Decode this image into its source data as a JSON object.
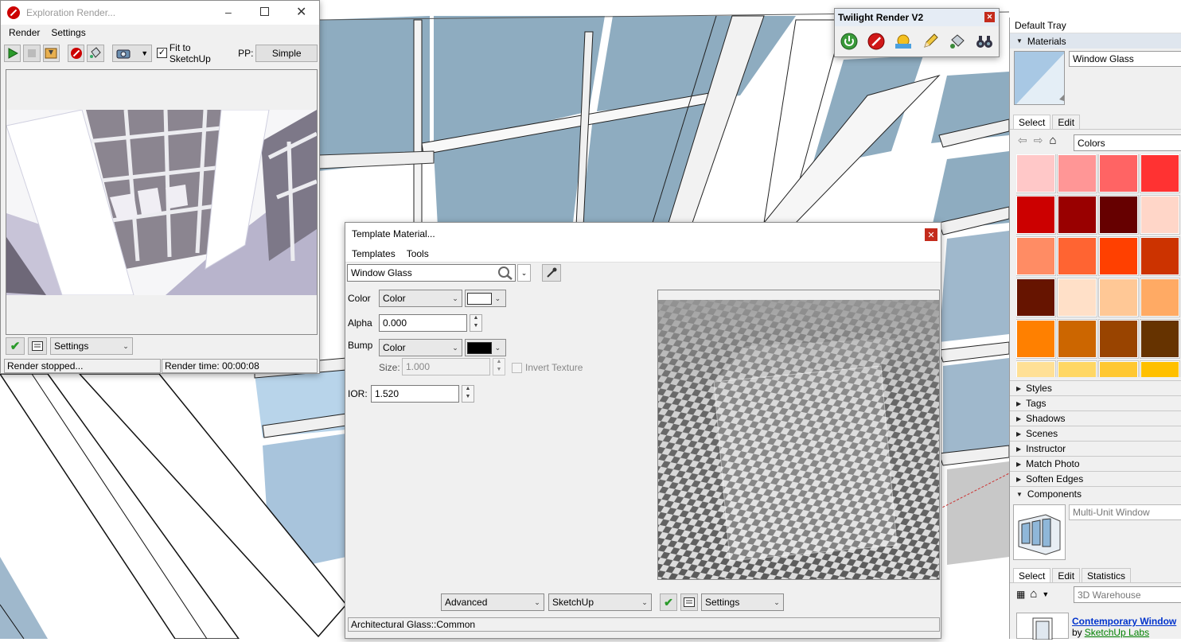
{
  "exploration": {
    "title": "Exploration Render...",
    "menu": [
      "Render",
      "Settings"
    ],
    "fit_label": "Fit to SketchUp",
    "pp_label": "PP:",
    "pp_value": "Simple",
    "settings_value": "Settings",
    "status_left": "Render stopped...",
    "status_right": "Render time: 00:00:08"
  },
  "twilight": {
    "title": "Twilight Render V2",
    "icons": [
      "power-icon",
      "render-icon",
      "sun-icon",
      "pencil-icon",
      "paint-bucket-icon",
      "binoculars-icon"
    ]
  },
  "template": {
    "title": "Template Material...",
    "menu": [
      "Templates",
      "Tools"
    ],
    "material_name": "Window Glass",
    "color_label": "Color",
    "color_type": "Color",
    "color_swatch": "#ffffff",
    "alpha_label": "Alpha",
    "alpha_value": "0.000",
    "bump_label": "Bump",
    "bump_type": "Color",
    "bump_swatch": "#000000",
    "size_label": "Size:",
    "size_value": "1.000",
    "invert_label": "Invert Texture",
    "ior_label": "IOR:",
    "ior_value": "1.520",
    "mode_value": "Advanced",
    "engine_value": "SketchUp",
    "settings_value": "Settings",
    "status": "Architectural Glass::Common"
  },
  "tray": {
    "title": "Default Tray",
    "materials_header": "Materials",
    "material_name": "Window Glass",
    "tabs": [
      "Select",
      "Edit"
    ],
    "library": "Colors",
    "swatches": [
      "#ffc8c8",
      "#ff9696",
      "#ff6464",
      "#ff3232",
      "#cc0000",
      "#990000",
      "#660000",
      "#ffd6c8",
      "#ff8c64",
      "#ff6432",
      "#ff4000",
      "#cc3300",
      "#661400",
      "#ffe0c8",
      "#ffc896",
      "#ffaa64",
      "#ff8000",
      "#cc6600",
      "#994400",
      "#663300",
      "#ffe096",
      "#ffd764",
      "#ffc832",
      "#ffc000"
    ],
    "sections": [
      "Styles",
      "Tags",
      "Shadows",
      "Scenes",
      "Instructor",
      "Match Photo",
      "Soften Edges",
      "Components"
    ],
    "component_name": "Multi-Unit Window",
    "comp_tabs": [
      "Select",
      "Edit",
      "Statistics"
    ],
    "warehouse": "3D Warehouse",
    "result_title": "Contemporary Window",
    "result_by": "by",
    "result_author": "SketchUp Labs"
  }
}
